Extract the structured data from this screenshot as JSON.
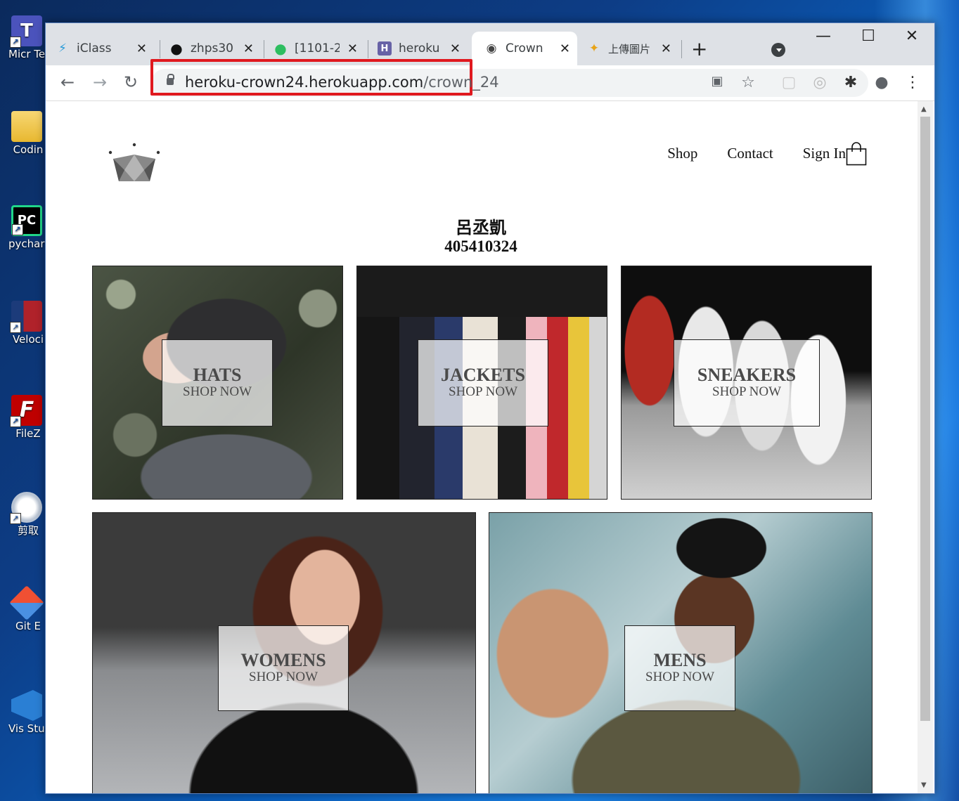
{
  "desktop": {
    "icons": [
      {
        "name": "teams",
        "label": "Micr Tea",
        "color": "#4b53bc",
        "glyph": "T"
      },
      {
        "name": "folder",
        "label": "Codin",
        "color": "#f2c94c",
        "glyph": ""
      },
      {
        "name": "pycharm",
        "label": "pychar - 提",
        "color": "#21d789",
        "glyph": "PC"
      },
      {
        "name": "velocity",
        "label": "Veloci",
        "color": "#b0222a",
        "glyph": ""
      },
      {
        "name": "filezilla",
        "label": "FileZ",
        "color": "#bf0000",
        "glyph": "F"
      },
      {
        "name": "snip",
        "label": "剪取",
        "color": "#dfe6f0",
        "glyph": ""
      },
      {
        "name": "git",
        "label": "Git E",
        "color": "#f05033",
        "glyph": ""
      },
      {
        "name": "vs",
        "label": "Vis Studio",
        "color": "#2a7fd4",
        "glyph": ""
      }
    ]
  },
  "browser": {
    "tabs": [
      {
        "label": "iClass",
        "icon": "iclass-icon",
        "glyph": "⚡",
        "color": "#2a9bd8"
      },
      {
        "label": "zhps30",
        "icon": "github-icon",
        "glyph": "●",
        "color": "#111"
      },
      {
        "label": "[1101-2",
        "icon": "evernote-icon",
        "glyph": "●",
        "color": "#2dbe60"
      },
      {
        "label": "heroku",
        "icon": "heroku-icon",
        "glyph": "H",
        "color": "#6762a6"
      },
      {
        "label": "Crown",
        "icon": "globe-icon",
        "glyph": "◉",
        "color": "#555"
      },
      {
        "label": "上傳圖片",
        "icon": "photos-icon",
        "glyph": "✦",
        "color": "#e8a317"
      }
    ],
    "url_host": "heroku-crown24.herokuapp.com",
    "url_path": "/crown_24"
  },
  "page": {
    "nav": {
      "shop": "Shop",
      "contact": "Contact",
      "signin": "Sign In"
    },
    "author_name": "呂丞凱",
    "student_id": "405410324",
    "categories": [
      {
        "title": "HATS",
        "subtitle": "SHOP NOW"
      },
      {
        "title": "JACKETS",
        "subtitle": "SHOP NOW"
      },
      {
        "title": "SNEAKERS",
        "subtitle": "SHOP NOW"
      },
      {
        "title": "WOMENS",
        "subtitle": "SHOP NOW"
      },
      {
        "title": "MENS",
        "subtitle": "SHOP NOW"
      }
    ]
  }
}
